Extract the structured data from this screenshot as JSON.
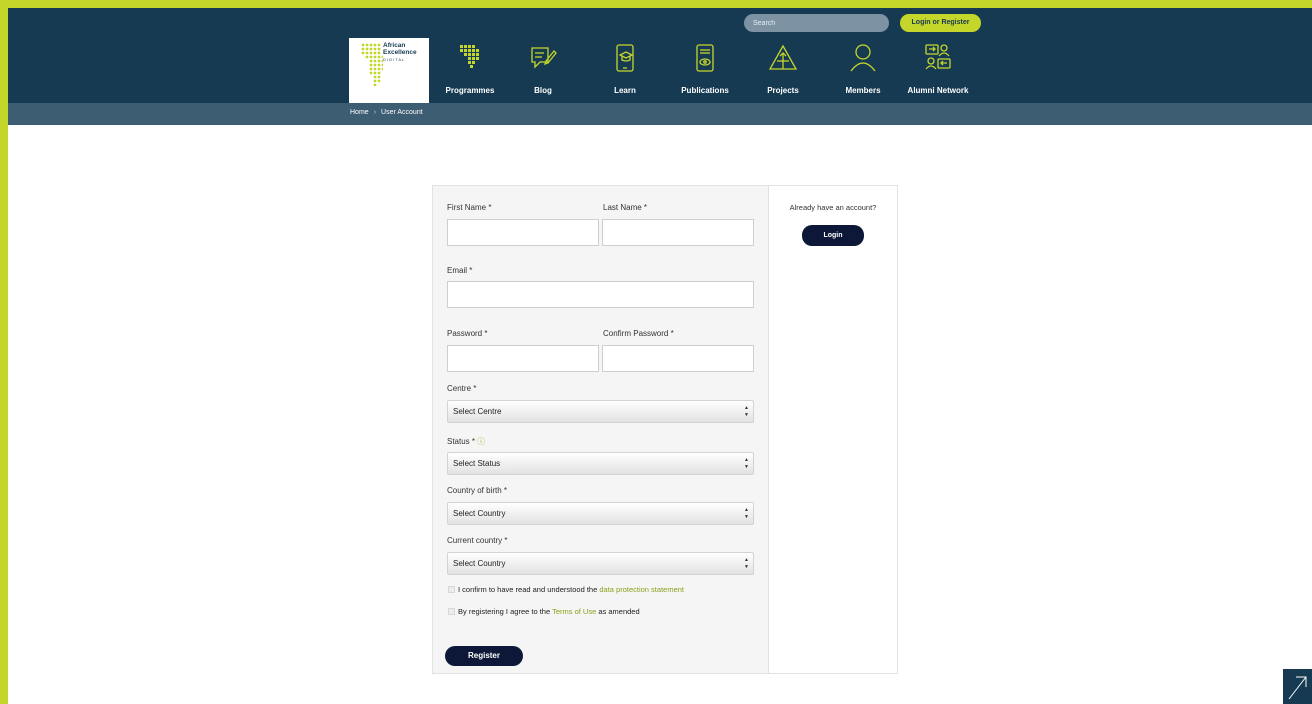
{
  "header": {
    "search_placeholder": "Search",
    "login_register_label": "Login or Register",
    "logo_text_line1": "African",
    "logo_text_line2": "Excellence",
    "logo_text_line3": "DIGITAL",
    "nav": [
      {
        "label": "Programmes",
        "icon": "africa-map-icon"
      },
      {
        "label": "Blog",
        "icon": "blog-icon"
      },
      {
        "label": "Learn",
        "icon": "learn-icon"
      },
      {
        "label": "Publications",
        "icon": "publications-icon"
      },
      {
        "label": "Projects",
        "icon": "projects-icon"
      },
      {
        "label": "Members",
        "icon": "members-icon"
      },
      {
        "label": "Alumni Network",
        "icon": "alumni-network-icon"
      }
    ]
  },
  "breadcrumb": {
    "home": "Home",
    "separator": "›",
    "current": "User Account"
  },
  "form": {
    "first_name_label": "First Name *",
    "last_name_label": "Last Name *",
    "email_label": "Email *",
    "password_label": "Password *",
    "confirm_password_label": "Confirm Password *",
    "centre_label": "Centre *",
    "centre_value": "Select Centre",
    "status_label": "Status *",
    "status_info_icon": "ⓘ",
    "status_value": "Select Status",
    "country_birth_label": "Country of birth *",
    "country_birth_value": "Select Country",
    "current_country_label": "Current country *",
    "current_country_value": "Select Country",
    "confirm_text": "I confirm to have read and understood the",
    "confirm_link": "data protection statement",
    "terms_text_before": "By registering I agree to the",
    "terms_link": "Terms of Use",
    "terms_text_after": "as amended",
    "register_label": "Register"
  },
  "side": {
    "already_text": "Already have an account?",
    "login_label": "Login"
  },
  "colors": {
    "brand_lime": "#c5d62b",
    "header_navy": "#163a52",
    "button_dark": "#0d1838"
  }
}
